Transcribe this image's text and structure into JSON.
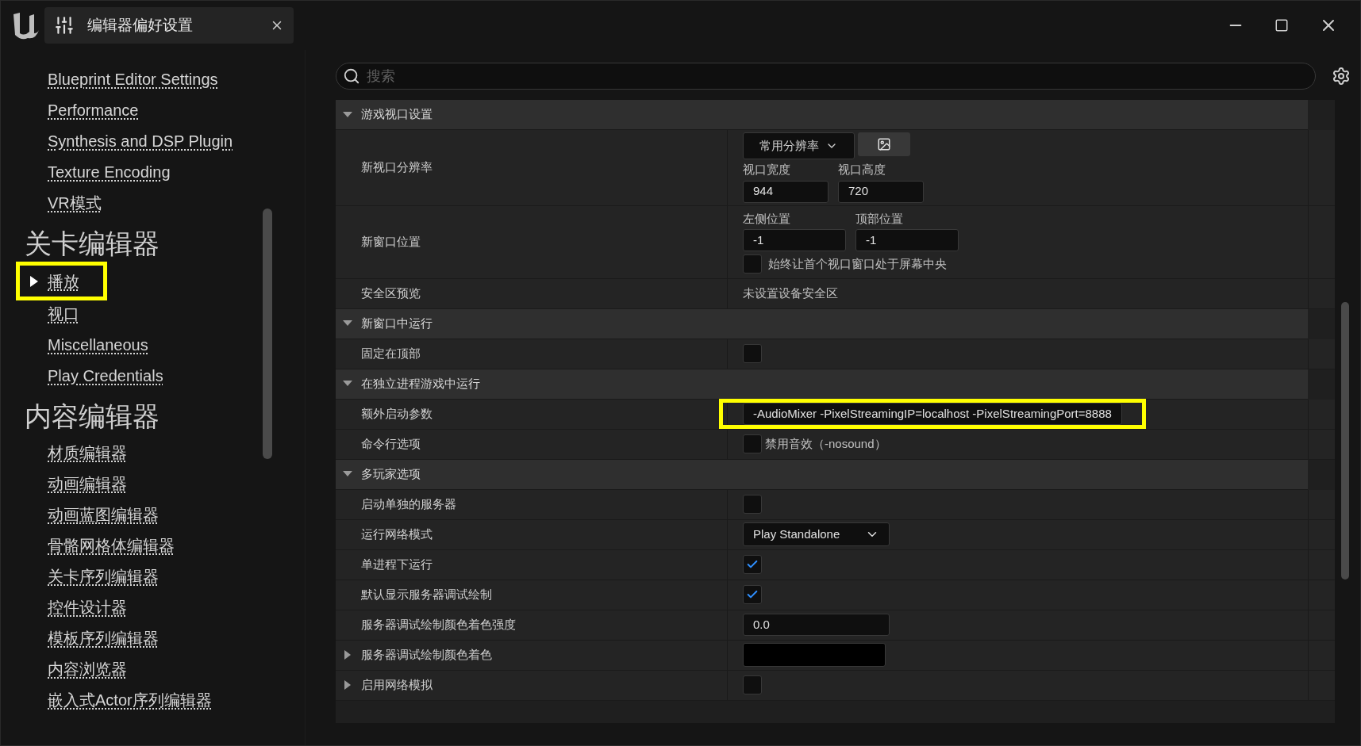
{
  "window": {
    "title": "编辑器偏好设置"
  },
  "sidebar": {
    "items": [
      {
        "kind": "link",
        "label": "Blueprint Editor Settings",
        "selected": false,
        "highlighted": false
      },
      {
        "kind": "link",
        "label": "Performance",
        "selected": false,
        "highlighted": false
      },
      {
        "kind": "link",
        "label": "Synthesis and DSP Plugin",
        "selected": false,
        "highlighted": false
      },
      {
        "kind": "link",
        "label": "Texture Encoding",
        "selected": false,
        "highlighted": false
      },
      {
        "kind": "link",
        "label": "VR模式",
        "selected": false,
        "highlighted": false
      },
      {
        "kind": "heading",
        "label": "关卡编辑器"
      },
      {
        "kind": "link",
        "label": "播放",
        "selected": true,
        "highlighted": true
      },
      {
        "kind": "link",
        "label": "视口",
        "selected": false,
        "highlighted": false
      },
      {
        "kind": "link",
        "label": "Miscellaneous",
        "selected": false,
        "highlighted": false
      },
      {
        "kind": "link",
        "label": "Play Credentials",
        "selected": false,
        "highlighted": false
      },
      {
        "kind": "heading",
        "label": "内容编辑器"
      },
      {
        "kind": "link",
        "label": "材质编辑器",
        "selected": false,
        "highlighted": false
      },
      {
        "kind": "link",
        "label": "动画编辑器",
        "selected": false,
        "highlighted": false
      },
      {
        "kind": "link",
        "label": "动画蓝图编辑器",
        "selected": false,
        "highlighted": false
      },
      {
        "kind": "link",
        "label": "骨骼网格体编辑器",
        "selected": false,
        "highlighted": false
      },
      {
        "kind": "link",
        "label": "关卡序列编辑器",
        "selected": false,
        "highlighted": false
      },
      {
        "kind": "link",
        "label": "控件设计器",
        "selected": false,
        "highlighted": false
      },
      {
        "kind": "link",
        "label": "模板序列编辑器",
        "selected": false,
        "highlighted": false
      },
      {
        "kind": "link",
        "label": "内容浏览器",
        "selected": false,
        "highlighted": false
      },
      {
        "kind": "link",
        "label": "嵌入式Actor序列编辑器",
        "selected": false,
        "highlighted": false
      }
    ]
  },
  "search": {
    "placeholder": "搜索"
  },
  "sections": [
    {
      "title": "游戏视口设置",
      "expanded": true,
      "rows": [
        {
          "kind": "resolution",
          "label": "新视口分辨率",
          "preset": "常用分辨率",
          "fields": [
            {
              "label": "视口宽度",
              "value": "944"
            },
            {
              "label": "视口高度",
              "value": "720"
            }
          ]
        },
        {
          "kind": "position",
          "label": "新窗口位置",
          "fields": [
            {
              "label": "左侧位置",
              "value": "-1"
            },
            {
              "label": "顶部位置",
              "value": "-1"
            }
          ],
          "option": {
            "label": "始终让首个视口窗口处于屏幕中央",
            "checked": false
          }
        },
        {
          "kind": "text",
          "label": "安全区预览",
          "value": "未设置设备安全区"
        }
      ]
    },
    {
      "title": "新窗口中运行",
      "expanded": true,
      "rows": [
        {
          "kind": "checkbox",
          "label": "固定在顶部",
          "checked": false
        }
      ]
    },
    {
      "title": "在独立进程游戏中运行",
      "expanded": true,
      "rows": [
        {
          "kind": "field",
          "label": "额外启动参数",
          "value": "-AudioMixer -PixelStreamingIP=localhost -PixelStreamingPort=8888",
          "highlighted": true
        },
        {
          "kind": "checkbox",
          "label": "命令行选项",
          "checked": false,
          "option": "禁用音效（-nosound）"
        }
      ]
    },
    {
      "title": "多玩家选项",
      "expanded": true,
      "rows": [
        {
          "kind": "checkbox",
          "label": "启动单独的服务器",
          "checked": false
        },
        {
          "kind": "dropdown",
          "label": "运行网络模式",
          "value": "Play Standalone"
        },
        {
          "kind": "checkbox",
          "label": "单进程下运行",
          "checked": true
        },
        {
          "kind": "checkbox",
          "label": "默认显示服务器调试绘制",
          "checked": true
        },
        {
          "kind": "field",
          "label": "服务器调试绘制颜色着色强度",
          "value": "0.0",
          "highlighted": false
        },
        {
          "kind": "color",
          "label": "服务器调试绘制颜色着色",
          "color": "#000000",
          "expanded": false
        },
        {
          "kind": "checkbox",
          "label": "启用网络模拟",
          "checked": false,
          "expanded": false
        }
      ]
    }
  ]
}
